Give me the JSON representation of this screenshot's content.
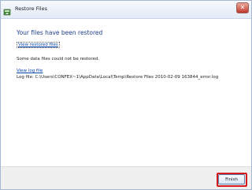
{
  "window": {
    "title": "Restore Files"
  },
  "content": {
    "heading": "Your files have been restored",
    "view_restored_link": "View restored files",
    "partial_message": "Some data files could not be restored.",
    "view_log_link": "View log file",
    "log_path": "Log file: C:\\Users\\CONFEX~1\\AppData\\Local\\Temp\\Restore Files 2010-02-09 163844_error.log"
  },
  "footer": {
    "finish_label": "Finish"
  },
  "colors": {
    "heading": "#1e3f8a",
    "link": "#0645ad",
    "highlight": "#d41a1a"
  },
  "icons": {
    "app": "restore-files-icon",
    "close": "close-icon"
  }
}
